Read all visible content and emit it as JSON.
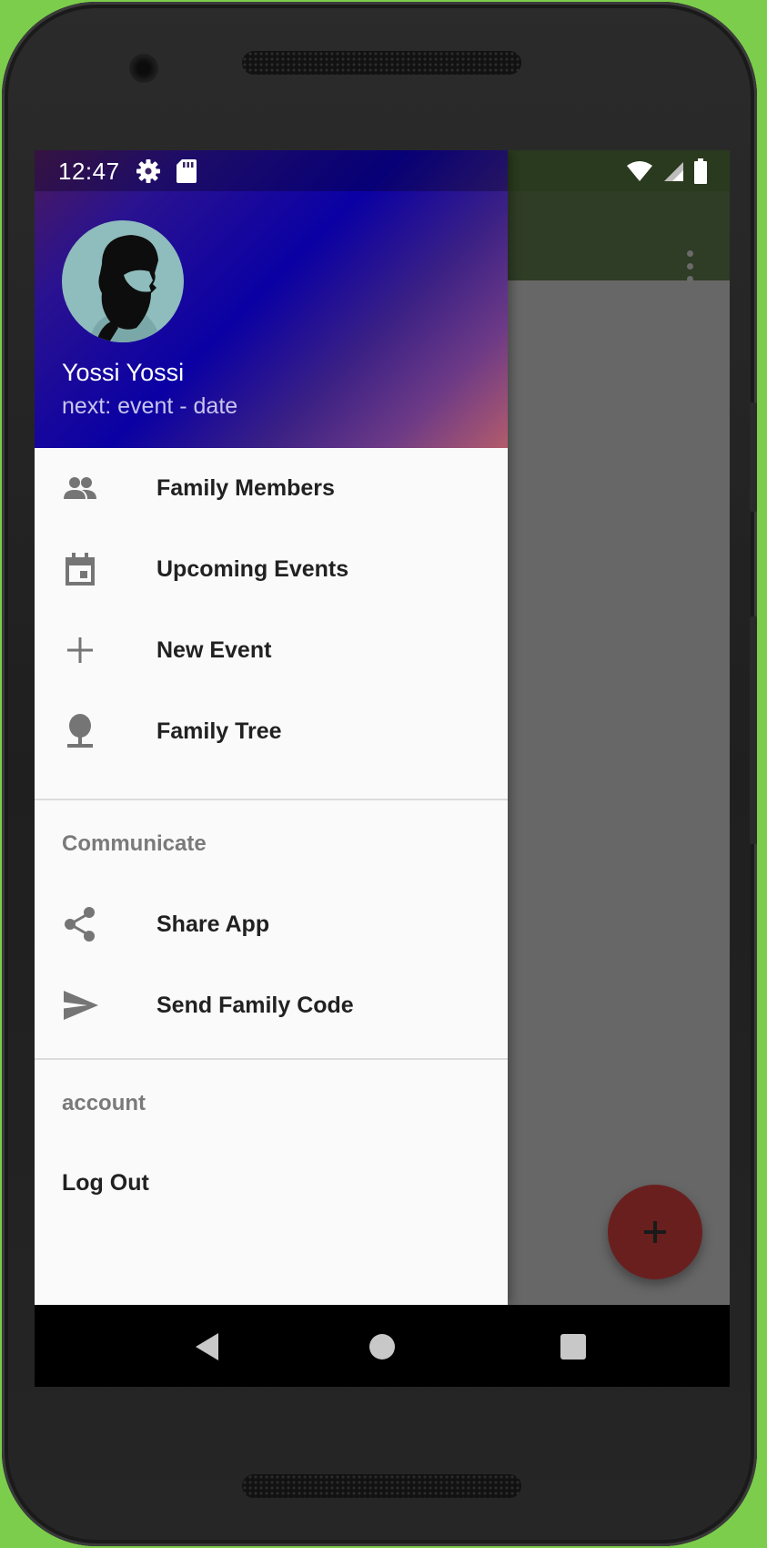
{
  "status_bar": {
    "time": "12:47",
    "left_icons": [
      "gear-icon",
      "sd-card-icon"
    ],
    "right_icons": [
      "wifi-icon",
      "signal-icon",
      "battery-icon"
    ]
  },
  "drawer": {
    "header": {
      "avatar": "bearded-man-avatar",
      "user_name": "Yossi Yossi",
      "next_event": "next: event - date"
    },
    "primary_items": [
      {
        "label": "Family Members",
        "icon": "people-icon"
      },
      {
        "label": "Upcoming Events",
        "icon": "calendar-icon"
      },
      {
        "label": "New Event",
        "icon": "plus-icon"
      },
      {
        "label": "Family Tree",
        "icon": "tree-icon"
      }
    ],
    "communicate": {
      "header": "Communicate",
      "items": [
        {
          "label": "Share App",
          "icon": "share-icon"
        },
        {
          "label": "Send Family Code",
          "icon": "send-icon"
        }
      ]
    },
    "account": {
      "header": "account",
      "items": [
        {
          "label": "Log Out"
        }
      ]
    }
  },
  "toolbar": {
    "menu_icon": "overflow-menu-icon"
  },
  "fab": {
    "icon": "plus-icon"
  },
  "nav_bar": {
    "icons": [
      "back-icon",
      "home-icon",
      "recents-icon"
    ]
  },
  "colors": {
    "device_background": "#7ccd4c",
    "toolbar": "#2f3c26",
    "fab": "#6a1f1f",
    "drawer_background": "#fafafa"
  }
}
